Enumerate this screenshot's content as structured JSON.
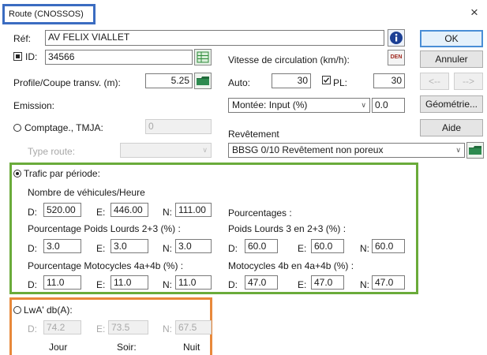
{
  "title": "Route (CNOSSOS)",
  "close_glyph": "×",
  "colors": {
    "title_frame": "#3b6cc1",
    "traffic_frame": "#6aab3a",
    "lwa_frame": "#e8883a",
    "ok_border": "#4a8ed6"
  },
  "icons": [
    "info-icon",
    "grid-icon",
    "folder-icon",
    "den-icon"
  ],
  "ref": {
    "label": "Réf:",
    "value": "AV FELIX VIALLET"
  },
  "id": {
    "label": "ID:",
    "value": "34566"
  },
  "profile": {
    "label": "Profile/Coupe transv. (m):",
    "value": "5.25"
  },
  "emission": {
    "label": "Emission:"
  },
  "comptage": {
    "label": "Comptage., TMJA:",
    "value": "0"
  },
  "type_route": {
    "label": "Type route:"
  },
  "speed": {
    "label": "Vitesse de circulation (km/h):",
    "den": "DEN",
    "auto_label": "Auto:",
    "auto_value": "30",
    "pl_label": "PL:",
    "pl_value": "30"
  },
  "montee": {
    "selected": "Montée: Input (%)",
    "value": "0.0"
  },
  "revetement": {
    "label": "Revêtement",
    "selected": "BBSG 0/10 Revêtement non poreux"
  },
  "buttons": {
    "ok": "OK",
    "annuler": "Annuler",
    "prev": "<--",
    "next": "-->",
    "geometrie": "Géométrie...",
    "aide": "Aide"
  },
  "trafic": {
    "label": "Trafic par période:",
    "vehicles_label": "Nombre de véhicules/Heure",
    "vehicles": {
      "D": "520.00",
      "E": "446.00",
      "N": "111.00"
    },
    "pourcentages_label": "Pourcentages :",
    "pl23_label": "Pourcentage Poids Lourds 2+3 (%) :",
    "pl23": {
      "D": "3.0",
      "E": "3.0",
      "N": "3.0"
    },
    "pl3_label": "Poids Lourds 3 en 2+3 (%) :",
    "pl3": {
      "D": "60.0",
      "E": "60.0",
      "N": "60.0"
    },
    "moto_label": "Pourcentage Motocycles  4a+4b (%) :",
    "moto": {
      "D": "11.0",
      "E": "11.0",
      "N": "11.0"
    },
    "moto4b_label": "Motocycles 4b en 4a+4b (%) :",
    "moto4b": {
      "D": "47.0",
      "E": "47.0",
      "N": "47.0"
    }
  },
  "lwa": {
    "label": "LwA' db(A):",
    "D": "74.2",
    "E": "73.5",
    "N": "67.5",
    "jour": "Jour",
    "soir": "Soir:",
    "nuit": "Nuit"
  },
  "period_letters": {
    "D": "D:",
    "E": "E:",
    "N": "N:"
  }
}
